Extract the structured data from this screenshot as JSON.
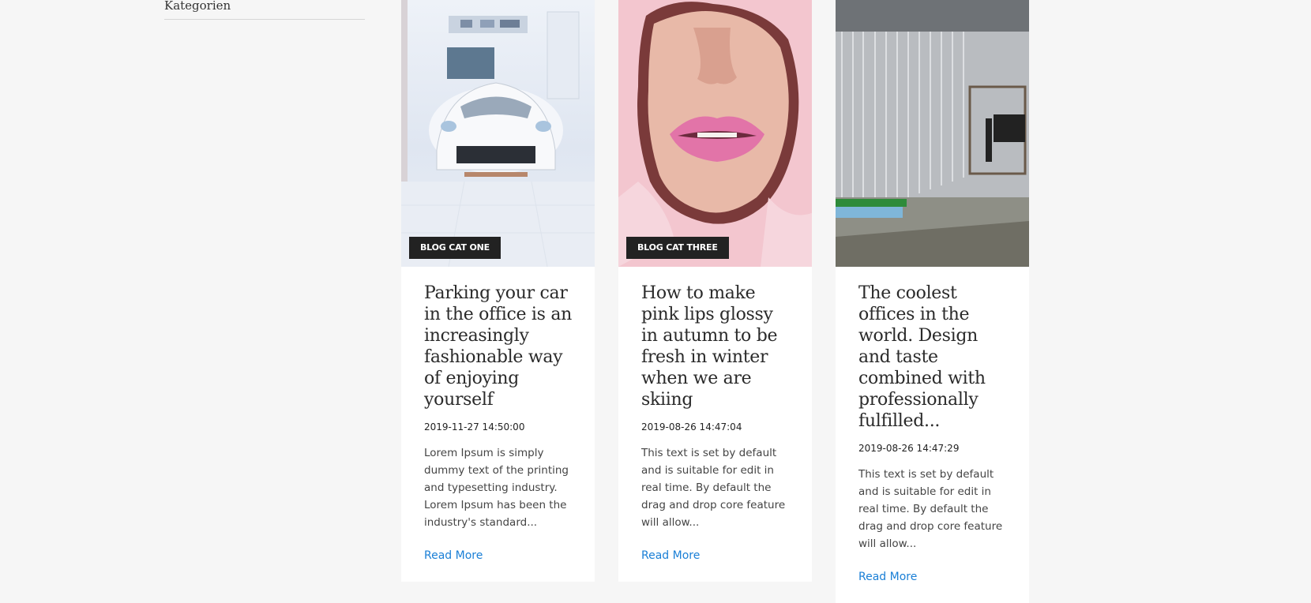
{
  "sidebar": {
    "heading": "Kategorien"
  },
  "posts": [
    {
      "category": "BLOG CAT ONE",
      "title": "Parking your car in the office is an increasingly fashionable way of enjoying yourself",
      "date": "2019-11-27 14:50:00",
      "excerpt": "Lorem Ipsum is simply dummy text of the printing and typesetting industry. Lorem Ipsum has been the industry's standard...",
      "read_more": "Read More"
    },
    {
      "category": "BLOG CAT THREE",
      "title": "How to make pink lips glossy in autumn to be fresh in winter when we are skiing",
      "date": "2019-08-26 14:47:04",
      "excerpt": "This text is set by default and is suitable for edit in real time. By default the drag and drop core feature will allow...",
      "read_more": "Read More"
    },
    {
      "category": "",
      "title": "The coolest offices in the world. Design and taste combined with professionally fulfilled...",
      "date": "2019-08-26 14:47:29",
      "excerpt": "This text is set by default and is suitable for edit in real time. By default the drag and drop core feature will allow...",
      "read_more": "Read More"
    }
  ],
  "colors": {
    "page_background": "#f6f6f6",
    "badge_background": "#222222",
    "link": "#1a7fd6"
  }
}
